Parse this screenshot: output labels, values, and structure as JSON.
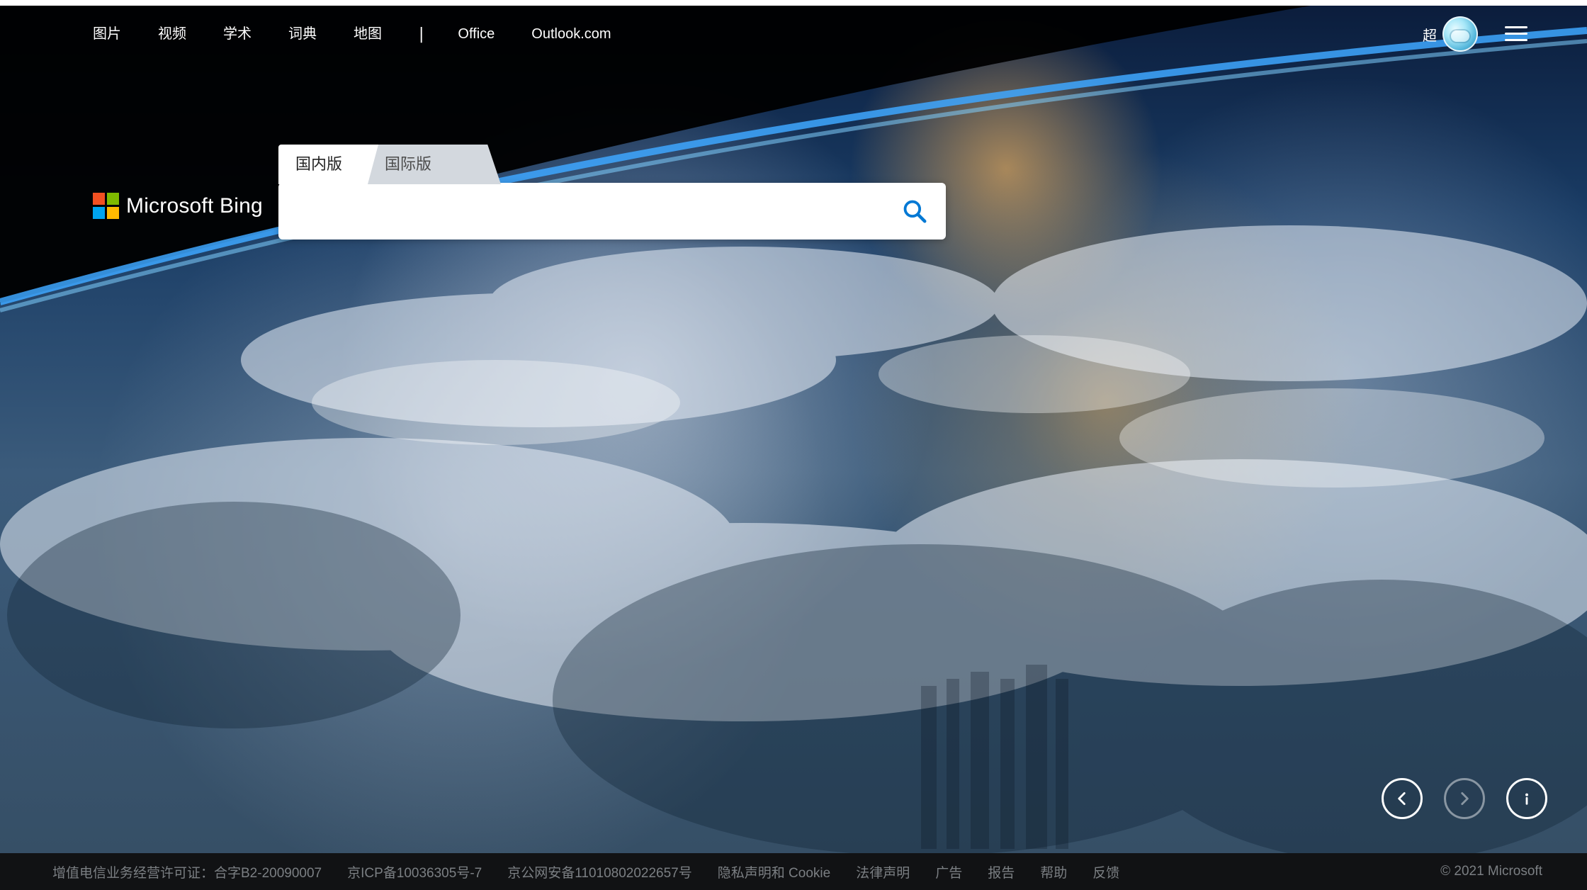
{
  "top_nav": {
    "links": [
      "图片",
      "视频",
      "学术",
      "词典",
      "地图"
    ],
    "separator": "|",
    "ext_links": [
      "Office",
      "Outlook.com"
    ],
    "user_name": "超"
  },
  "brand": {
    "name": "Microsoft Bing"
  },
  "search": {
    "tabs": [
      "国内版",
      "国际版"
    ],
    "query": "",
    "placeholder": ""
  },
  "footer": {
    "items": [
      "增值电信业务经营许可证：合字B2-20090007",
      "京ICP备10036305号-7",
      "京公网安备11010802022657号",
      "隐私声明和 Cookie",
      "法律声明",
      "广告",
      "报告",
      "帮助",
      "反馈"
    ],
    "copyright": "© 2021 Microsoft"
  },
  "icons": {
    "search": "search-icon",
    "menu": "hamburger-menu-icon",
    "prev": "chevron-left-icon",
    "next": "chevron-right-icon",
    "info": "info-icon"
  },
  "colors": {
    "footer_bg": "#121416",
    "footer_text": "#7b7f83",
    "accent": "#0078d4"
  }
}
